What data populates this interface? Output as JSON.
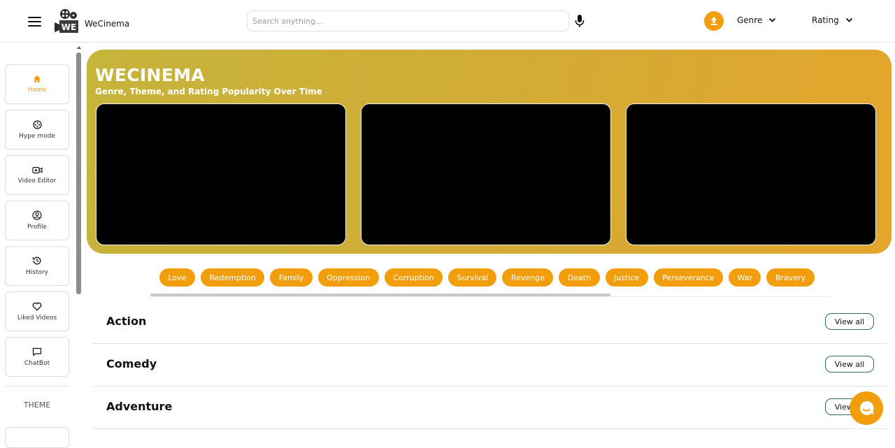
{
  "header": {
    "brand": "WeCinema",
    "logo_text": "WE",
    "search_placeholder": "Search anything...",
    "genre_label": "Genre",
    "rating_label": "Rating"
  },
  "sidebar": {
    "items": [
      {
        "label": "Home",
        "icon": "home-icon",
        "active": true
      },
      {
        "label": "Hype mode",
        "icon": "film-reel-icon"
      },
      {
        "label": "Video Editor",
        "icon": "video-add-icon"
      },
      {
        "label": "Profile",
        "icon": "user-circle-icon"
      },
      {
        "label": "History",
        "icon": "history-icon"
      },
      {
        "label": "Liked Videos",
        "icon": "heart-icon"
      },
      {
        "label": "ChatBot",
        "icon": "chat-icon"
      }
    ],
    "theme_label": "THEME"
  },
  "hero": {
    "title": "WECINEMA",
    "subtitle": "Genre, Theme, and Rating Popularity Over Time"
  },
  "tags": [
    "Love",
    "Redemption",
    "Family",
    "Oppression",
    "Corruption",
    "Survival",
    "Revenge",
    "Death",
    "Justice",
    "Perseverance",
    "War",
    "Bravery"
  ],
  "categories": [
    {
      "title": "Action",
      "button": "View all"
    },
    {
      "title": "Comedy",
      "button": "View all"
    },
    {
      "title": "Adventure",
      "button": "View all"
    }
  ],
  "colors": {
    "accent": "#f29e0c",
    "hero_start": "#c6b43b",
    "hero_end": "#e4a52c",
    "view_all_border": "#2f6b5c"
  }
}
